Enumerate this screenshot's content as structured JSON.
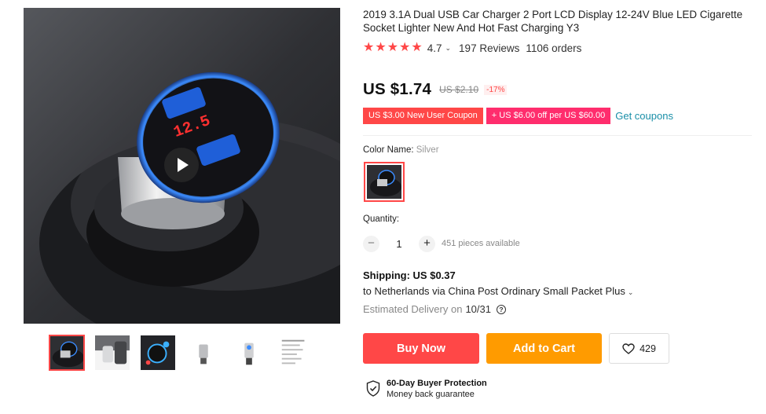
{
  "product": {
    "title": "2019 3.1A Dual USB Car Charger 2 Port LCD Display 12-24V Blue LED Cigarette Socket Lighter New And Hot Fast Charging Y3",
    "image_display": "12.5",
    "rating": {
      "stars": 4.7,
      "value": "4.7",
      "reviews": "197 Reviews",
      "orders": "1106 orders"
    },
    "price": {
      "current": "US $1.74",
      "original": "US $2.10",
      "discount": "-17%"
    },
    "coupons": [
      "US $3.00 New User Coupon",
      "+ US $6.00 off per US $60.00"
    ],
    "get_coupons": "Get coupons"
  },
  "color": {
    "label": "Color Name:",
    "value": "Silver"
  },
  "quantity": {
    "label": "Quantity:",
    "value": "1",
    "minus": "−",
    "plus": "+",
    "available": "451 pieces available"
  },
  "shipping": {
    "title": "Shipping: US $0.37",
    "route": "to Netherlands via China Post Ordinary Small Packet Plus",
    "delivery_label": "Estimated Delivery on",
    "delivery_date": "10/31",
    "help": "?"
  },
  "actions": {
    "buy_now": "Buy Now",
    "add_to_cart": "Add to Cart",
    "wishlist_count": "429"
  },
  "protection": {
    "title": "60-Day Buyer Protection",
    "subtitle": "Money back guarantee"
  },
  "colors": {
    "accent": "#ff4747",
    "cart": "#ff9b00",
    "coupon_pink": "#ff2d6d",
    "link": "#1a8fa8"
  }
}
